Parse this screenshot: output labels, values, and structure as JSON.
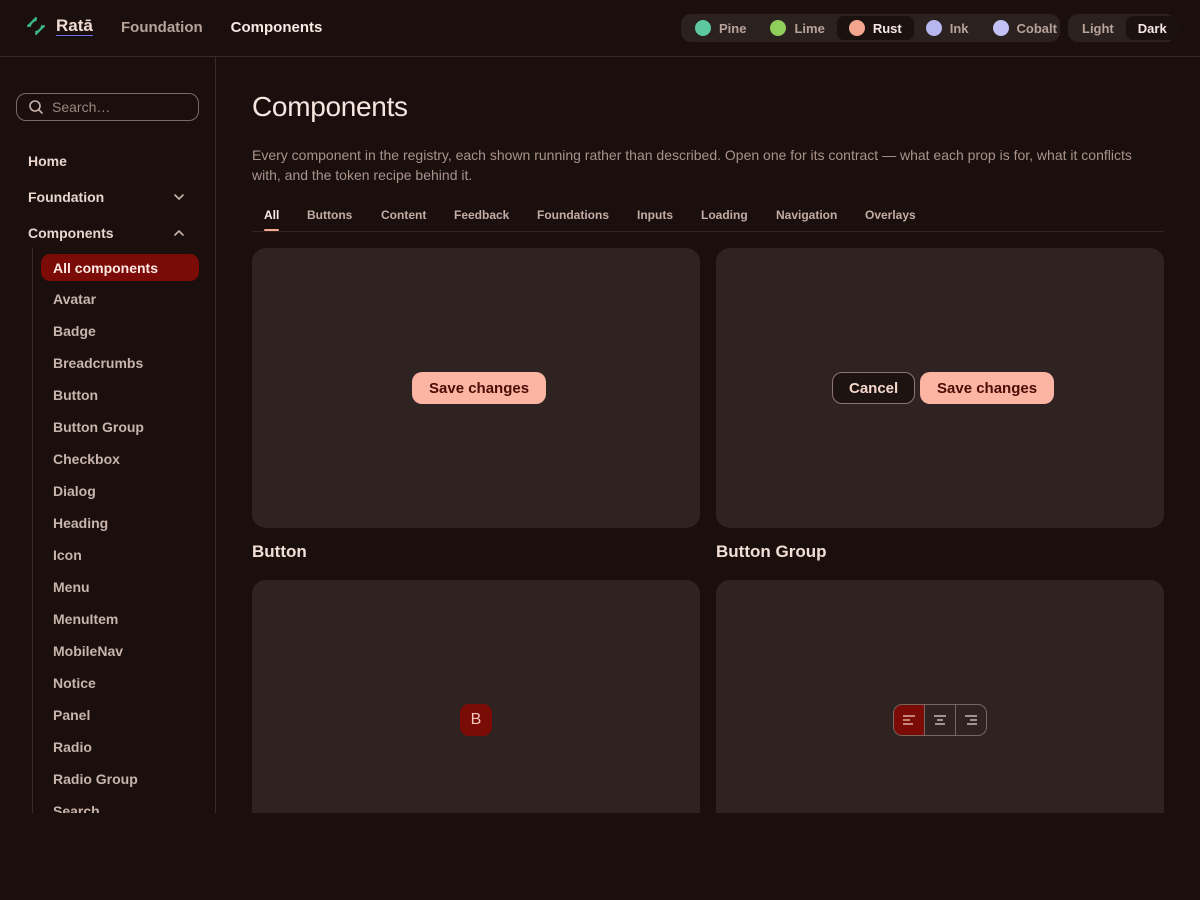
{
  "colors": {
    "accent": "#7a0b06",
    "primary_button": "#fdb5a3",
    "background": "#1a0f0d",
    "card": "#2e2320"
  },
  "header": {
    "brand": "Ratā",
    "nav": [
      "Foundation",
      "Components"
    ],
    "active_nav": "Components",
    "themes": [
      {
        "label": "Pine",
        "color": "#5cc9a0"
      },
      {
        "label": "Lime",
        "color": "#8fce5a"
      },
      {
        "label": "Rust",
        "color": "#f3a68d"
      },
      {
        "label": "Ink",
        "color": "#b7b7f0"
      },
      {
        "label": "Cobalt",
        "color": "#c3c1f6"
      }
    ],
    "active_theme": "Rust",
    "modes": [
      "Light",
      "Dark"
    ],
    "active_mode": "Dark"
  },
  "sidebar": {
    "search_placeholder": "Search…",
    "top_items": [
      "Home",
      "Foundation",
      "Components"
    ],
    "active_sub": "All components",
    "sub_items": [
      "Avatar",
      "Badge",
      "Breadcrumbs",
      "Button",
      "Button Group",
      "Checkbox",
      "Dialog",
      "Heading",
      "Icon",
      "Menu",
      "MenuItem",
      "MobileNav",
      "Notice",
      "Panel",
      "Radio",
      "Radio Group",
      "Search"
    ]
  },
  "main": {
    "title": "Components",
    "intro": "Every component in the registry, each shown running rather than described. Open one for its contract — what each prop is for, what it conflicts with, and the token recipe behind it.",
    "tabs": [
      "All",
      "Buttons",
      "Content",
      "Feedback",
      "Foundations",
      "Inputs",
      "Loading",
      "Navigation",
      "Overlays"
    ],
    "active_tab": "All",
    "cards": [
      {
        "title": "Button",
        "primary_label": "Save changes"
      },
      {
        "title": "Button Group",
        "secondary_label": "Cancel",
        "primary_label": "Save changes"
      },
      {
        "avatar_letter": "B"
      },
      {
        "align_icons": [
          "align-left-icon",
          "align-center-icon",
          "align-right-icon"
        ]
      }
    ]
  }
}
